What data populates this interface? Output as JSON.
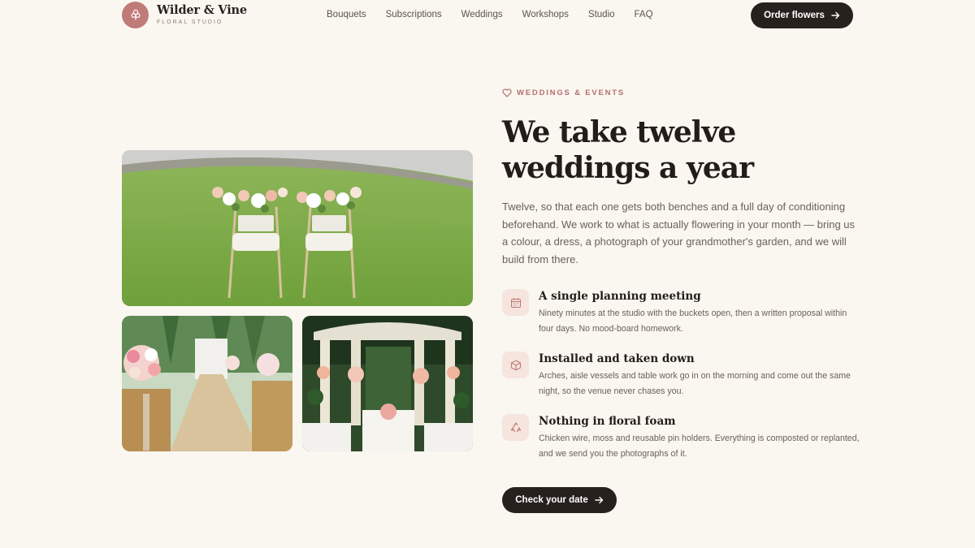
{
  "brand": {
    "name": "Wilder & Vine",
    "subtitle": "FLORAL STUDIO",
    "logo_icon": "flower-icon"
  },
  "nav": {
    "links": [
      "Bouquets",
      "Subscriptions",
      "Weddings",
      "Workshops",
      "Studio",
      "FAQ"
    ],
    "cta_label": "Order flowers",
    "cta_icon": "arrow-right-icon"
  },
  "gallery": {
    "images": [
      {
        "name": "photo-wedding-chairs",
        "icon": "photo"
      },
      {
        "name": "photo-aisle-flowers",
        "icon": "photo"
      },
      {
        "name": "photo-gazebo",
        "icon": "photo"
      }
    ]
  },
  "hero": {
    "eyebrow": "WEDDINGS & EVENTS",
    "eyebrow_icon": "heart-icon",
    "title": "We take twelve weddings a year",
    "lede": "Twelve, so that each one gets both benches and a full day of conditioning beforehand. We work to what is actually flowering in your month — bring us a colour, a dress, a photograph of your grandmother's garden, and we will build from there.",
    "features": [
      {
        "icon": "calendar-icon",
        "title": "A single planning meeting",
        "description": "Ninety minutes at the studio with the buckets open, then a written proposal within four days. No mood-board homework."
      },
      {
        "icon": "box-icon",
        "title": "Installed and taken down",
        "description": "Arches, aisle vessels and table work go in on the morning and come out the same night, so the venue never chases you."
      },
      {
        "icon": "recycle-icon",
        "title": "Nothing in floral foam",
        "description": "Chicken wire, moss and reusable pin holders. Everything is composted or replanted, and we send you the photographs of it."
      }
    ],
    "cta_label": "Check your date",
    "cta_icon": "arrow-right-icon"
  },
  "colors": {
    "background": "#faf6f0",
    "accent": "#c07a78",
    "dark": "#27211e",
    "icon_tile": "#f5e5de"
  }
}
